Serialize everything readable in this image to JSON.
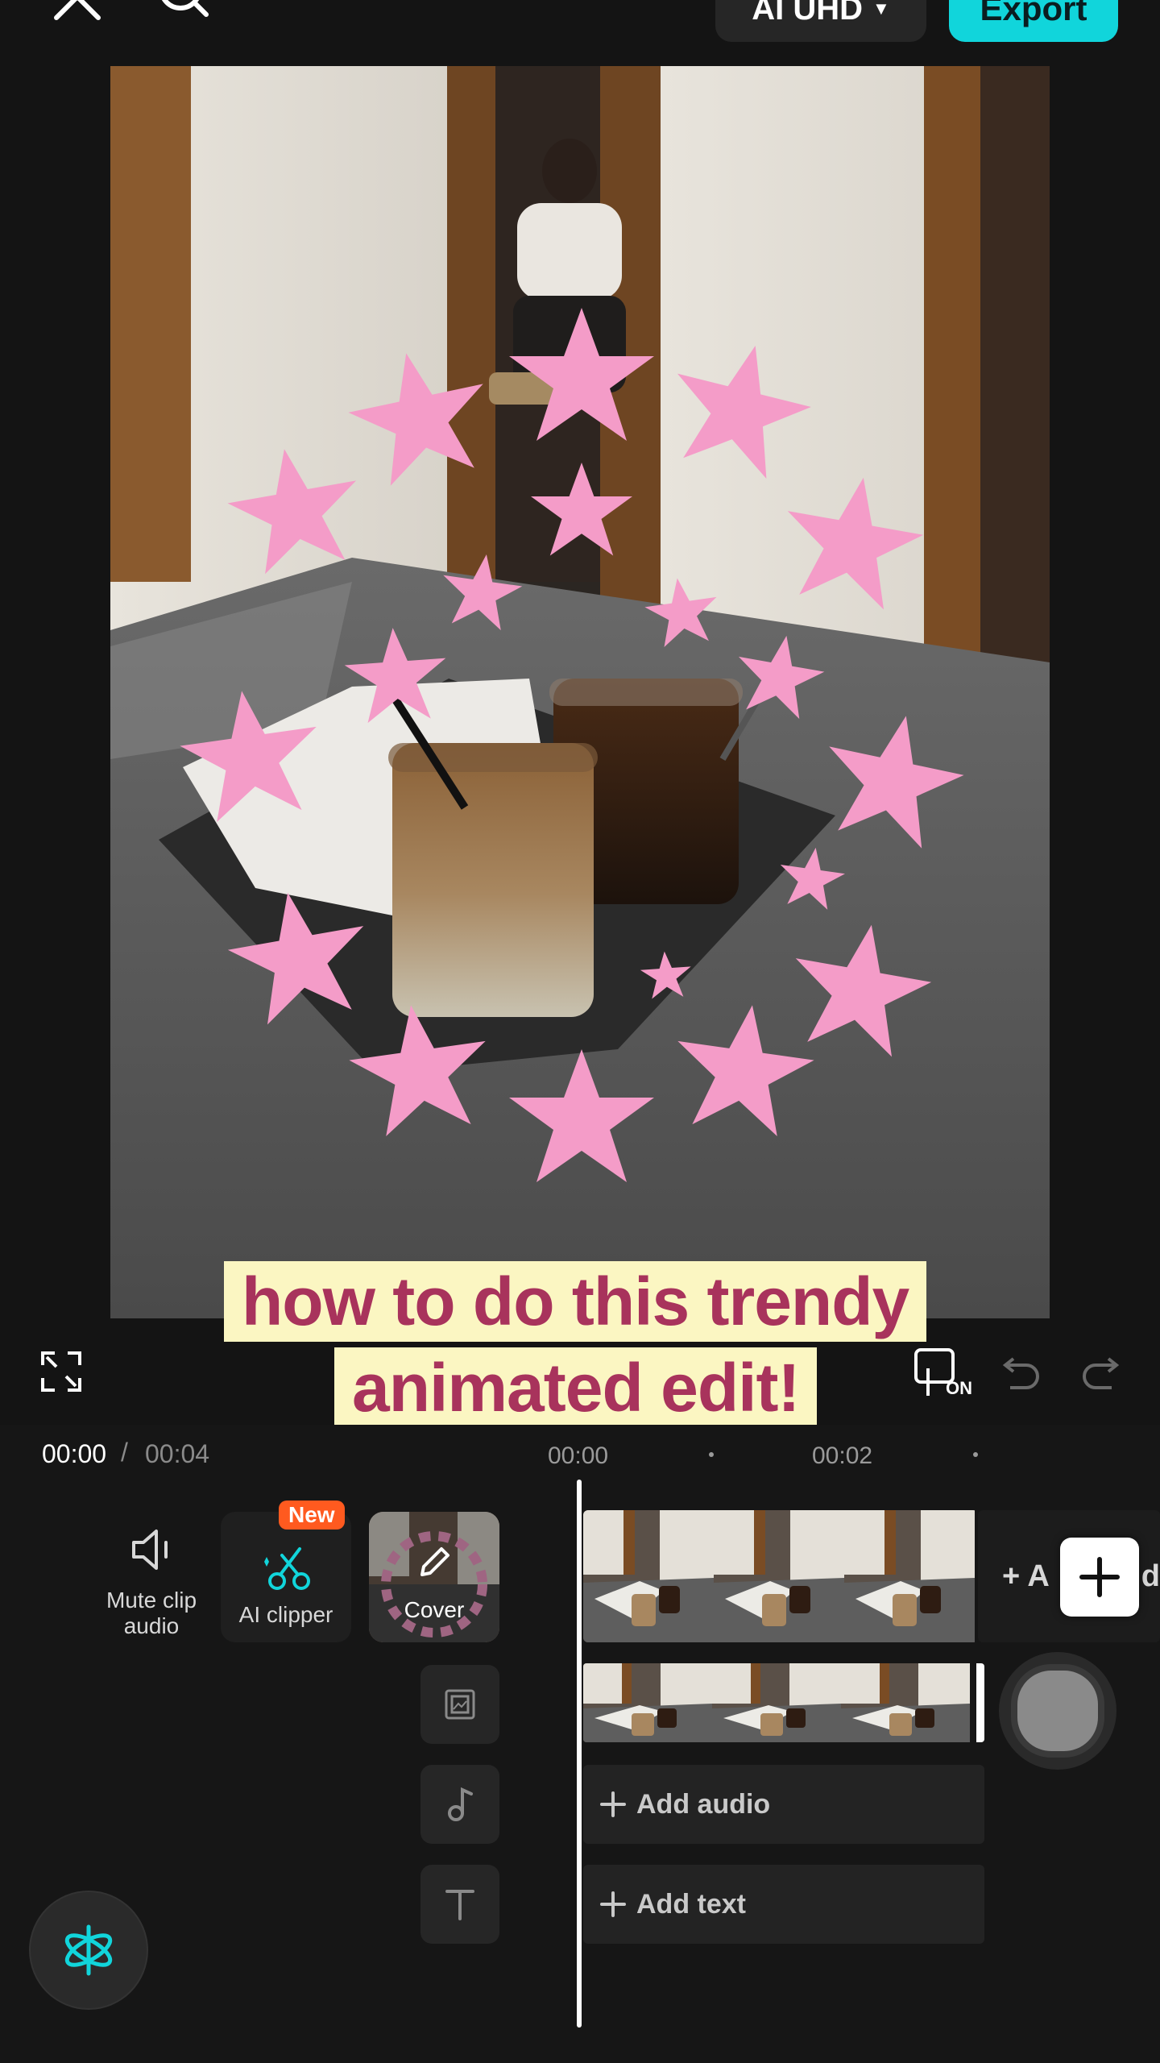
{
  "topbar": {
    "close_icon": "close-icon",
    "search_icon": "search-icon",
    "quality_label": "AI UHD",
    "export_label": "Export"
  },
  "preview": {
    "caption_line1": "how to do this trendy",
    "caption_line2": "animated edit!",
    "colors": {
      "caption_bg": "#fbf6c2",
      "caption_text": "#a8335c",
      "stars": "#f49cc8"
    }
  },
  "controls": {
    "fullscreen_icon": "fullscreen-icon",
    "preview_axis_icon": "preview-axis-icon",
    "preview_axis_state": "ON",
    "undo_icon": "undo-icon",
    "redo_icon": "redo-icon"
  },
  "timeline": {
    "current_time": "00:00",
    "separator": "/",
    "total_time": "00:04",
    "ruler_marks": [
      "00:00",
      "00:02"
    ],
    "tools": {
      "mute_label_1": "Mute clip",
      "mute_label_2": "audio",
      "ai_clipper_label": "AI clipper",
      "new_badge": "New",
      "cover_label": "Cover"
    },
    "tracks": {
      "add_audio": "Add audio",
      "add_text": "Add text",
      "add_partial": "+ A",
      "add_partial_end": "d"
    },
    "accent_color": "#11d5db"
  }
}
